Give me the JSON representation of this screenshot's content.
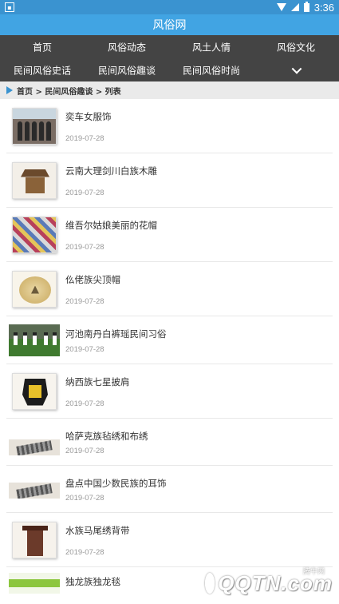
{
  "status_bar": {
    "time": "3:36",
    "battery": "",
    "left_icon": "notification-icon"
  },
  "app": {
    "title": "风俗网"
  },
  "nav": {
    "row1": [
      "首页",
      "风俗动态",
      "风土人情",
      "风俗文化"
    ],
    "row2": [
      "民间风俗史话",
      "民间风俗趣谈",
      "民间风俗时尚"
    ],
    "more_icon": "chevron-down-icon"
  },
  "breadcrumb": {
    "text": "首页 > 民间风俗趣谈 > 列表"
  },
  "articles": [
    {
      "title": "奕车女服饰",
      "date": "2019-07-28"
    },
    {
      "title": "云南大理剑川白族木雕",
      "date": "2019-07-28"
    },
    {
      "title": "维吾尔姑娘美丽的花帽",
      "date": "2019-07-28"
    },
    {
      "title": "仫佬族尖顶帽",
      "date": "2019-07-28"
    },
    {
      "title": "河池南丹白裤瑶民间习俗",
      "date": "2019-07-28"
    },
    {
      "title": "纳西族七星披肩",
      "date": "2019-07-28"
    },
    {
      "title": "哈萨克族毡绣和布绣",
      "date": "2019-07-28"
    },
    {
      "title": "盘点中国少数民族的耳饰",
      "date": "2019-07-28"
    },
    {
      "title": "水族马尾绣背带",
      "date": "2019-07-28"
    },
    {
      "title": "独龙族独龙毯",
      "date": ""
    }
  ],
  "watermark": {
    "text": "QQTN.com",
    "small": "腾牛网"
  }
}
